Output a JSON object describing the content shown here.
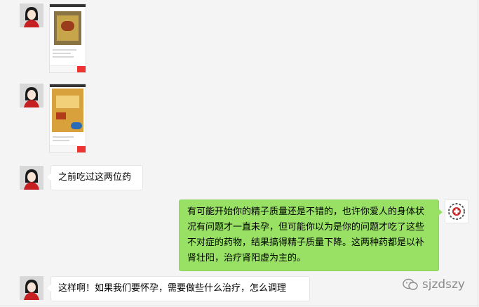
{
  "chat": {
    "messages": [
      {
        "sender": "customer",
        "type": "image",
        "description_icon": "product-screenshot-icon"
      },
      {
        "sender": "customer",
        "type": "image",
        "description_icon": "product-screenshot-icon"
      },
      {
        "sender": "customer",
        "type": "text",
        "text": "之前吃过这两位药"
      },
      {
        "sender": "doctor",
        "type": "text",
        "text": "有可能开始你的精子质量还是不错的，也许你爱人的身体状况有问题才一直未孕，但可能你以为是你的问题才吃了这些不对症的药物，结果搞得精子质量下降。这两种药都是以补肾壮阳，治疗肾阳虚为主的。"
      },
      {
        "sender": "customer",
        "type": "text",
        "text": "这样啊！如果我们要怀孕，需要做些什么治疗，怎么调理"
      }
    ]
  },
  "watermark": {
    "handle": "sjzdszy",
    "icon": "wechat-icon"
  },
  "colors": {
    "sent_bubble": "#98e165",
    "received_bubble": "#ffffff",
    "background": "#f4f4f4"
  }
}
